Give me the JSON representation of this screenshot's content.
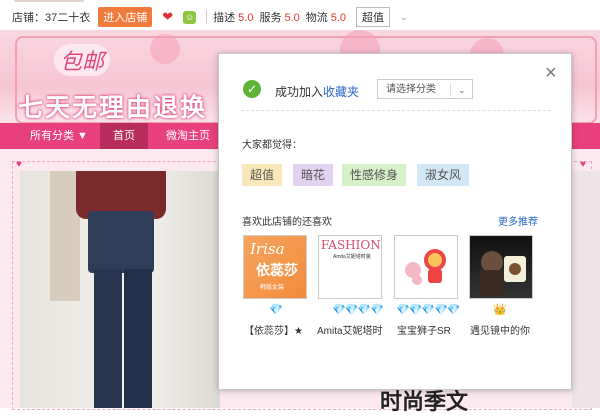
{
  "shopbar": {
    "shop_label": "店铺：",
    "shop_name": "37二十衣",
    "enter_label": "进入店铺",
    "heart_icon": "heart-icon",
    "wangwang_icon": "wangwang-icon",
    "scores": [
      {
        "label": "描述",
        "value": "5.0"
      },
      {
        "label": "服务",
        "value": "5.0"
      },
      {
        "label": "物流",
        "value": "5.0"
      }
    ],
    "value_label": "超值",
    "chevron": "⌄"
  },
  "banner": {
    "baoyou": "包邮",
    "slogan": "七天无理由退换"
  },
  "nav": {
    "items": [
      "所有分类 ▼",
      "首页",
      "微淘主页"
    ]
  },
  "page_bottom_text": "时尚季文",
  "popup": {
    "close": "×",
    "success_prefix": "成功加入",
    "success_link": "收藏夹",
    "category_placeholder": "请选择分类",
    "hint": "大家都觉得：",
    "tags": [
      {
        "label": "超值",
        "bg": "#f8e7b8"
      },
      {
        "label": "暗花",
        "bg": "#e2d2f2"
      },
      {
        "label": "性感修身",
        "bg": "#d6f0c8"
      },
      {
        "label": "淑女风",
        "bg": "#d3e8f6"
      }
    ],
    "like_title": "喜欢此店铺的还喜欢",
    "more_link": "更多推荐",
    "shops": [
      {
        "name": "【依蕊莎】★",
        "rank": "💎",
        "thumb_text": [
          "Irisa",
          "依蕊莎",
          "韩版女装"
        ]
      },
      {
        "name": "Amita艾妮塔时",
        "rank": "💎💎💎💎",
        "thumb_text": [
          "FASHION",
          "Amita艾妮塔时装"
        ]
      },
      {
        "name": "宝宝狮子SR",
        "rank": "💎💎💎💎💎",
        "thumb_text": []
      },
      {
        "name": "遇见镜中的你",
        "rank": "👑",
        "thumb_text": []
      }
    ]
  }
}
